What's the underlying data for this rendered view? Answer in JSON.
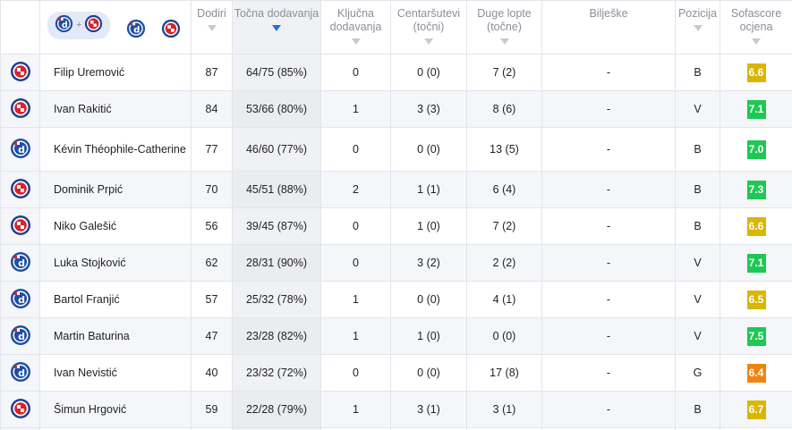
{
  "header": {
    "columns": [
      {
        "key": "touches",
        "label": "Dodiri"
      },
      {
        "key": "accurate_passes",
        "label": "Točna dodavanja"
      },
      {
        "key": "key_passes",
        "label": "Ključna dodavanja"
      },
      {
        "key": "crosses",
        "label": "Centaršutevi (točni)"
      },
      {
        "key": "long_balls",
        "label": "Duge lopte (točne)"
      },
      {
        "key": "notes",
        "label": "Bilješke"
      },
      {
        "key": "position",
        "label": "Pozicija"
      },
      {
        "key": "rating",
        "label": "Sofascore ocjena"
      }
    ],
    "team_filter": {
      "plus": "+"
    }
  },
  "colors": {
    "dinamo_blue": "#1f4fa0",
    "hajduk_red": "#d8232a",
    "rating_green": "#1ec853",
    "rating_yellow": "#d9b600",
    "rating_orange": "#ee8511",
    "sort_active": "#2c6ce6"
  },
  "players": [
    {
      "team": "hajduk",
      "name": "Filip Uremović",
      "touches": "87",
      "accurate_passes": "64/75 (85%)",
      "key_passes": "0",
      "crosses": "0 (0)",
      "long_balls": "7 (2)",
      "notes": "-",
      "position": "B",
      "rating": "6.6",
      "rating_color": "yellow"
    },
    {
      "team": "hajduk",
      "name": "Ivan Rakitić",
      "touches": "84",
      "accurate_passes": "53/66 (80%)",
      "key_passes": "1",
      "crosses": "3 (3)",
      "long_balls": "8 (6)",
      "notes": "-",
      "position": "V",
      "rating": "7.1",
      "rating_color": "green"
    },
    {
      "team": "dinamo",
      "name": "Kévin Théophile-Catherine",
      "touches": "77",
      "accurate_passes": "46/60 (77%)",
      "key_passes": "0",
      "crosses": "0 (0)",
      "long_balls": "13 (5)",
      "notes": "-",
      "position": "B",
      "rating": "7.0",
      "rating_color": "green"
    },
    {
      "team": "hajduk",
      "name": "Dominik Prpić",
      "touches": "70",
      "accurate_passes": "45/51 (88%)",
      "key_passes": "2",
      "crosses": "1 (1)",
      "long_balls": "6 (4)",
      "notes": "-",
      "position": "B",
      "rating": "7.3",
      "rating_color": "green"
    },
    {
      "team": "hajduk",
      "name": "Niko Galešić",
      "touches": "56",
      "accurate_passes": "39/45 (87%)",
      "key_passes": "0",
      "crosses": "1 (0)",
      "long_balls": "7 (2)",
      "notes": "-",
      "position": "B",
      "rating": "6.6",
      "rating_color": "yellow"
    },
    {
      "team": "dinamo",
      "name": "Luka Stojković",
      "touches": "62",
      "accurate_passes": "28/31 (90%)",
      "key_passes": "0",
      "crosses": "3 (2)",
      "long_balls": "2 (2)",
      "notes": "-",
      "position": "V",
      "rating": "7.1",
      "rating_color": "green"
    },
    {
      "team": "dinamo",
      "name": "Bartol Franjić",
      "touches": "57",
      "accurate_passes": "25/32 (78%)",
      "key_passes": "1",
      "crosses": "0 (0)",
      "long_balls": "4 (1)",
      "notes": "-",
      "position": "V",
      "rating": "6.5",
      "rating_color": "yellow"
    },
    {
      "team": "dinamo",
      "name": "Martin Baturina",
      "touches": "47",
      "accurate_passes": "23/28 (82%)",
      "key_passes": "1",
      "crosses": "1 (0)",
      "long_balls": "0 (0)",
      "notes": "-",
      "position": "V",
      "rating": "7.5",
      "rating_color": "green"
    },
    {
      "team": "dinamo",
      "name": "Ivan Nevistić",
      "touches": "40",
      "accurate_passes": "23/32 (72%)",
      "key_passes": "0",
      "crosses": "0 (0)",
      "long_balls": "17 (8)",
      "notes": "-",
      "position": "G",
      "rating": "6.4",
      "rating_color": "orange"
    },
    {
      "team": "hajduk",
      "name": "Šimun Hrgović",
      "touches": "59",
      "accurate_passes": "22/28 (79%)",
      "key_passes": "1",
      "crosses": "3 (1)",
      "long_balls": "3 (1)",
      "notes": "-",
      "position": "B",
      "rating": "6.7",
      "rating_color": "yellow"
    }
  ]
}
